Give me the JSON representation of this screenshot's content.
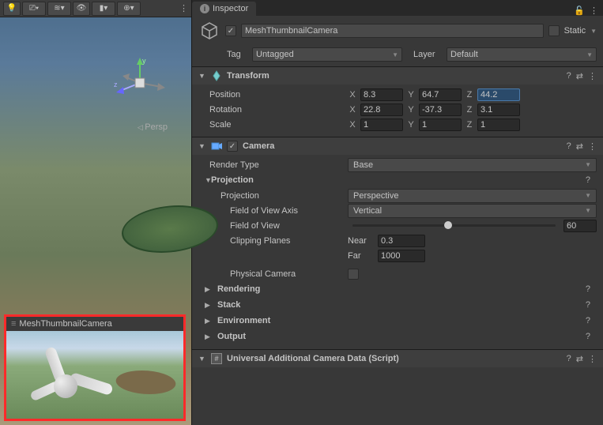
{
  "scene": {
    "persp_label": "Persp",
    "preview_title": "MeshThumbnailCamera"
  },
  "inspector": {
    "tab_label": "Inspector",
    "object_name": "MeshThumbnailCamera",
    "static_label": "Static",
    "tag_label": "Tag",
    "tag_value": "Untagged",
    "layer_label": "Layer",
    "layer_value": "Default"
  },
  "transform": {
    "title": "Transform",
    "position_label": "Position",
    "rotation_label": "Rotation",
    "scale_label": "Scale",
    "position": {
      "x": "8.3",
      "y": "64.7",
      "z": "44.2"
    },
    "rotation": {
      "x": "22.8",
      "y": "-37.3",
      "z": "3.1"
    },
    "scale": {
      "x": "1",
      "y": "1",
      "z": "1"
    }
  },
  "camera": {
    "title": "Camera",
    "render_type_label": "Render Type",
    "render_type_value": "Base",
    "projection_header": "Projection",
    "projection_label": "Projection",
    "projection_value": "Perspective",
    "fov_axis_label": "Field of View Axis",
    "fov_axis_value": "Vertical",
    "fov_label": "Field of View",
    "fov_value": "60",
    "clipping_label": "Clipping Planes",
    "near_label": "Near",
    "near_value": "0.3",
    "far_label": "Far",
    "far_value": "1000",
    "physical_label": "Physical Camera",
    "rendering_label": "Rendering",
    "stack_label": "Stack",
    "environment_label": "Environment",
    "output_label": "Output"
  },
  "urp": {
    "title": "Universal Additional Camera Data (Script)"
  },
  "axes": {
    "x": "x",
    "y": "y",
    "z": "z",
    "X": "X",
    "Y": "Y",
    "Z": "Z"
  }
}
